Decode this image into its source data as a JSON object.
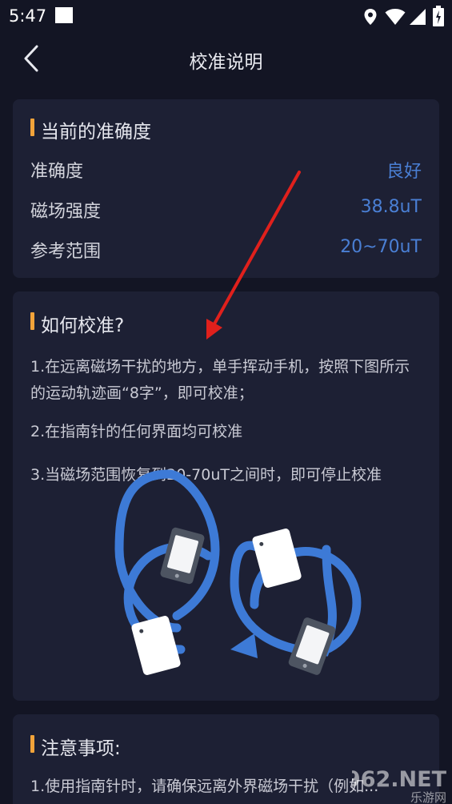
{
  "status_bar": {
    "time": "5:47",
    "icons": [
      "location-icon",
      "wifi-icon",
      "signal-icon",
      "battery-icon"
    ]
  },
  "header": {
    "title": "校准说明"
  },
  "accuracy_card": {
    "title": "当前的准确度",
    "rows": [
      {
        "label": "准确度",
        "value": "良好"
      },
      {
        "label": "磁场强度",
        "value": "38.8uT"
      },
      {
        "label": "参考范围",
        "value": "20~70uT"
      }
    ]
  },
  "howto_card": {
    "title": "如何校准?",
    "steps": [
      "1.在远离磁场干扰的地方，单手挥动手机，按照下图所示的运动轨迹画“8字”，即可校准；",
      "2.在指南针的任何界面均可校准",
      "3.当磁场范围恢复到20-70uT之间时，即可停止校准"
    ]
  },
  "notice_card": {
    "title": "注意事项:",
    "items": [
      "1.使用指南针时，请确保远离外界磁场干扰（例如..."
    ]
  },
  "watermark": {
    "text": "962.NET",
    "subtext": "乐游网"
  },
  "colors": {
    "background": "#131524",
    "card": "#1d2034",
    "accent": "#f2a33a",
    "value_blue": "#4a7fd4",
    "annotation_arrow": "#e0201c"
  }
}
